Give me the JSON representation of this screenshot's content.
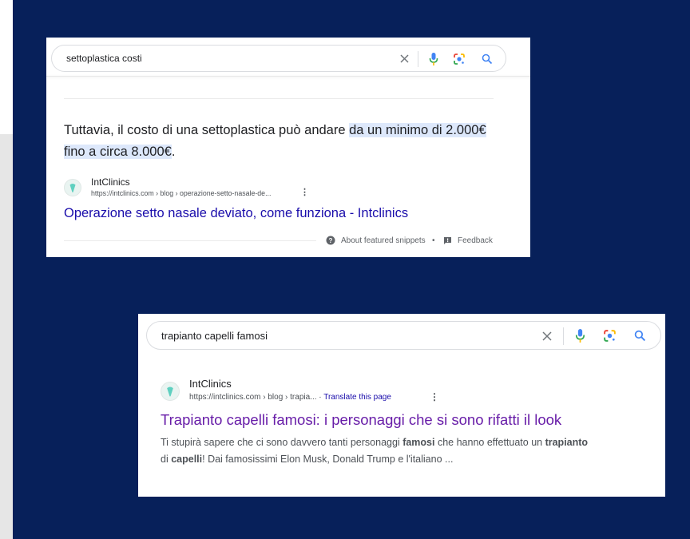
{
  "card1": {
    "query": "settoplastica costi",
    "answer_pre": "Tuttavia, il costo di una settoplastica può andare ",
    "answer_hl1": "da un minimo di 2.000€",
    "answer_hl2": "fino a circa 8.000€",
    "answer_post": ".",
    "site_name": "IntClinics",
    "url": "https://intclinics.com › blog › operazione-setto-nasale-de...",
    "title": "Operazione setto nasale deviato, come funziona - Intclinics",
    "about_label": "About featured snippets",
    "separator": "•",
    "feedback_label": "Feedback"
  },
  "card2": {
    "query": "trapianto capelli famosi",
    "site_name": "IntClinics",
    "url": "https://intclinics.com › blog › trapia...",
    "url_sep": " · ",
    "translate_label": "Translate this page",
    "title": "Trapianto capelli famosi: i personaggi che si sono rifatti il look",
    "snippet_line1_a": "Ti stupirà sapere che ci sono davvero tanti personaggi ",
    "snippet_line1_b": "famosi",
    "snippet_line1_c": " che hanno effettuato un ",
    "snippet_line1_d": "trapianto",
    "snippet_line2_a": "di ",
    "snippet_line2_b": "capelli",
    "snippet_line2_c": "! Dai famosissimi Elon Musk, Donald Trump e l'italiano ..."
  },
  "icons": [
    "clear-icon",
    "microphone-icon",
    "google-lens-icon",
    "search-icon",
    "favicon-icon",
    "more-options-icon",
    "help-icon",
    "feedback-icon"
  ],
  "colors": {
    "background": "#07205a",
    "link": "#1a0dab",
    "visited_link": "#681da8",
    "highlight": "#dde8fb",
    "mic_blue": "#4285f4"
  }
}
